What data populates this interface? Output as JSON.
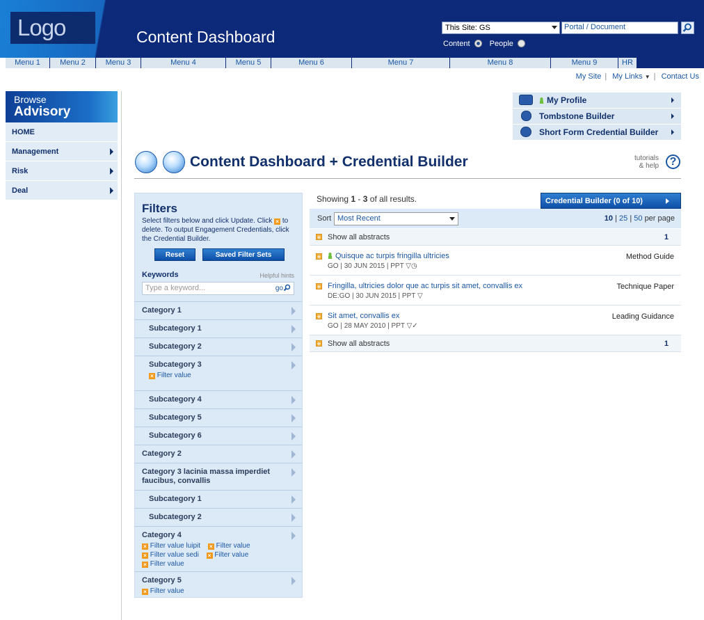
{
  "header": {
    "logo": "Logo",
    "title": "Content Dashboard",
    "site_select": "This Site: GS",
    "search_placeholder": "Portal / Document",
    "radio_content": "Content",
    "radio_people": "People"
  },
  "menu": [
    "Menu 1",
    "Menu 2",
    "Menu 3",
    "Menu 4",
    "Menu 5",
    "Menu 6",
    "Menu 7",
    "Menu 8",
    "Menu 9",
    "HR"
  ],
  "util_links": {
    "my_site": "My Site",
    "my_links": "My Links",
    "contact": "Contact Us"
  },
  "browse": {
    "line1": "Browse",
    "line2": "Advisory"
  },
  "leftnav": [
    {
      "label": "HOME"
    },
    {
      "label": "Management"
    },
    {
      "label": "Risk"
    },
    {
      "label": "Deal"
    }
  ],
  "profile_links": [
    {
      "label": "My Profile"
    },
    {
      "label": "Tombstone Builder"
    },
    {
      "label": "Short Form Credential Builder"
    }
  ],
  "page": {
    "title": "Content Dashboard + Credential Builder",
    "tutorials_line1": "tutorials",
    "tutorials_line2": "& help",
    "help_glyph": "?"
  },
  "filters": {
    "title": "Filters",
    "desc_part1": "Select filters below and click Update. Click",
    "desc_part2": "to delete. To output Engagement Credentials, click the Credential Builder.",
    "reset": "Reset",
    "saved_sets": "Saved Filter Sets",
    "keywords": "Keywords",
    "hints": "Helpful hints",
    "kw_placeholder": "Type a keyword...",
    "kw_go": "go",
    "categories": [
      {
        "label": "Category 1"
      },
      {
        "label": "Subcategory 1"
      },
      {
        "label": "Subcategory 2"
      },
      {
        "label": "Subcategory 3",
        "values": [
          "Filter value"
        ]
      },
      {
        "label": "Subcategory 4"
      },
      {
        "label": "Subcategory 5"
      },
      {
        "label": "Subcategory 6"
      },
      {
        "label": "Category 2"
      },
      {
        "label": "Category 3 lacinia massa imperdiet faucibus, convallis"
      },
      {
        "label": "Subcategory 1"
      },
      {
        "label": "Subcategory 2"
      },
      {
        "label": "Category 4",
        "values": [
          "Filter value luipit",
          "Filter value",
          "Filter value sedi",
          "Filter value",
          "Filter value"
        ]
      },
      {
        "label": "Category 5",
        "values": [
          "Filter value"
        ]
      }
    ]
  },
  "results": {
    "showing_prefix": "Showing",
    "showing_from": "1",
    "showing_to": "3",
    "showing_suffix": "of all results.",
    "credential_builder": "Credential Builder (0 of 10)",
    "sort_label": "Sort",
    "sort_value": "Most Recent",
    "per_page": {
      "current": "10",
      "opt1": "25",
      "opt2": "50",
      "suffix": "per page"
    },
    "show_all": "Show all abstracts",
    "show_all_count": "1",
    "items": [
      {
        "title": "Quisque ac turpis fringilla ultricies",
        "meta": "GO  |  30 JUN 2015  |  PPT",
        "type": "Method Guide",
        "person": true
      },
      {
        "title": "Fringilla, ultricies dolor que ac turpis sit amet, convallis ex",
        "meta": "DE:GO  |  30 JUN 2015  |  PPT",
        "type": "Technique Paper",
        "person": false
      },
      {
        "title": "Sit amet, convallis ex",
        "meta": "GO  |  28 MAY 2010  |  PPT",
        "type": "Leading Guidance",
        "person": false
      }
    ]
  }
}
